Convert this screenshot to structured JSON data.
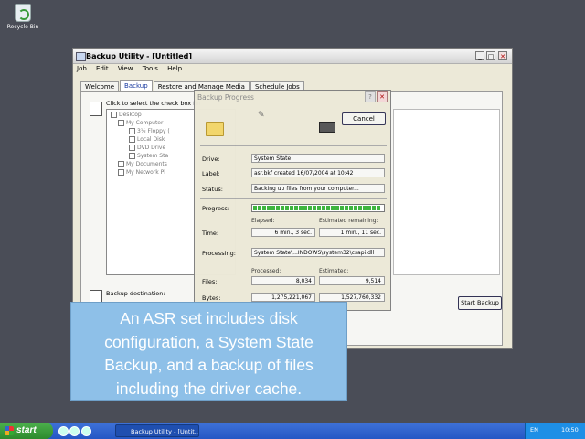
{
  "desktop": {
    "recycle_bin_label": "Recycle Bin"
  },
  "window": {
    "title": "Backup Utility - [Untitled]",
    "menu": [
      "Job",
      "Edit",
      "View",
      "Tools",
      "Help"
    ],
    "tabs": [
      "Welcome",
      "Backup",
      "Restore and Manage Media",
      "Schedule Jobs"
    ],
    "active_tab": "Backup",
    "hint": "Click to select the check box for",
    "tree": [
      "Desktop",
      "My Computer",
      "3½ Floppy (",
      "Local Disk",
      "DVD Drive",
      "System Sta",
      "My Documents",
      "My Network Pl"
    ],
    "backup_destination_label": "Backup destination:",
    "start_backup_label": "Start Backup"
  },
  "dialog": {
    "title": "Backup Progress",
    "cancel_label": "Cancel",
    "drive_label": "Drive:",
    "drive_value": "System State",
    "label_label": "Label:",
    "label_value": "asr.bkf created 16/07/2004 at 10:42",
    "status_label": "Status:",
    "status_value": "Backing up files from your computer...",
    "progress_label": "Progress:",
    "progress_fraction": 0.98,
    "elapsed_caption": "Elapsed:",
    "remaining_caption": "Estimated remaining:",
    "time_label": "Time:",
    "elapsed_value": "6 min., 3 sec.",
    "remaining_value": "1 min., 11 sec.",
    "processing_label": "Processing:",
    "processing_value": "System State\\...INDOWS\\system32\\csapi.dll",
    "processed_caption": "Processed:",
    "estimated_caption": "Estimated:",
    "files_label": "Files:",
    "files_processed": "8,034",
    "files_estimated": "9,514",
    "bytes_label": "Bytes:",
    "bytes_processed": "1,275,221,067",
    "bytes_estimated": "1,527,760,332"
  },
  "caption": {
    "lines": [
      "An ASR set includes disk",
      "configuration, a System State",
      "Backup, and a backup of files",
      "including the driver cache."
    ]
  },
  "taskbar": {
    "start_label": "start",
    "task_label": "Backup Utility - [Untit...",
    "language": "EN",
    "clock": "10:50"
  }
}
